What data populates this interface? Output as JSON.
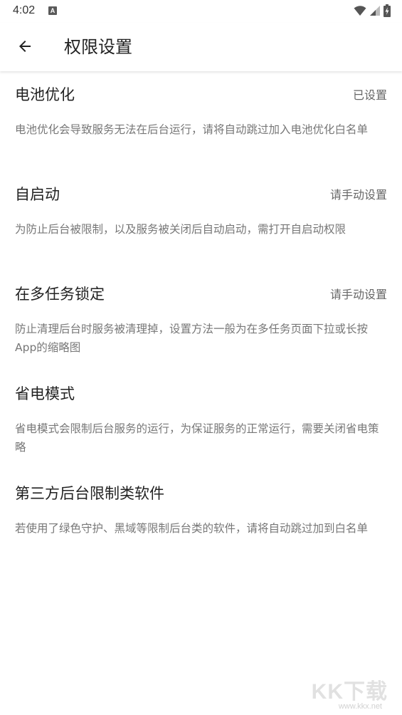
{
  "status_bar": {
    "time": "4:02",
    "notification_icon": "a-icon",
    "notification_letter": "A",
    "icons": [
      "wifi-icon",
      "signal-icon",
      "battery-charging-icon"
    ]
  },
  "app_bar": {
    "back_icon": "arrow-left-icon",
    "title": "权限设置"
  },
  "settings": [
    {
      "title": "电池优化",
      "status": "已设置",
      "description": "电池优化会导致服务无法在后台运行，请将自动跳过加入电池优化白名单"
    },
    {
      "title": "自启动",
      "status": "请手动设置",
      "description": "为防止后台被限制，以及服务被关闭后自动启动，需打开自启动权限"
    },
    {
      "title": "在多任务锁定",
      "status": "请手动设置",
      "description": "防止清理后台时服务被清理掉，设置方法一般为在多任务页面下拉或长按App的缩略图"
    },
    {
      "title": "省电模式",
      "status": "",
      "description": "省电模式会限制后台服务的运行，为保证服务的正常运行，需要关闭省电策略"
    },
    {
      "title": "第三方后台限制类软件",
      "status": "",
      "description": "若使用了绿色守护、黑域等限制后台类的软件，请将自动跳过加到白名单"
    }
  ],
  "watermark": {
    "text": "KK下载",
    "url": "www.kkx.net"
  },
  "colors": {
    "title_text": "#222222",
    "status_text": "#666666",
    "description_text": "#777777",
    "background": "#ffffff"
  }
}
